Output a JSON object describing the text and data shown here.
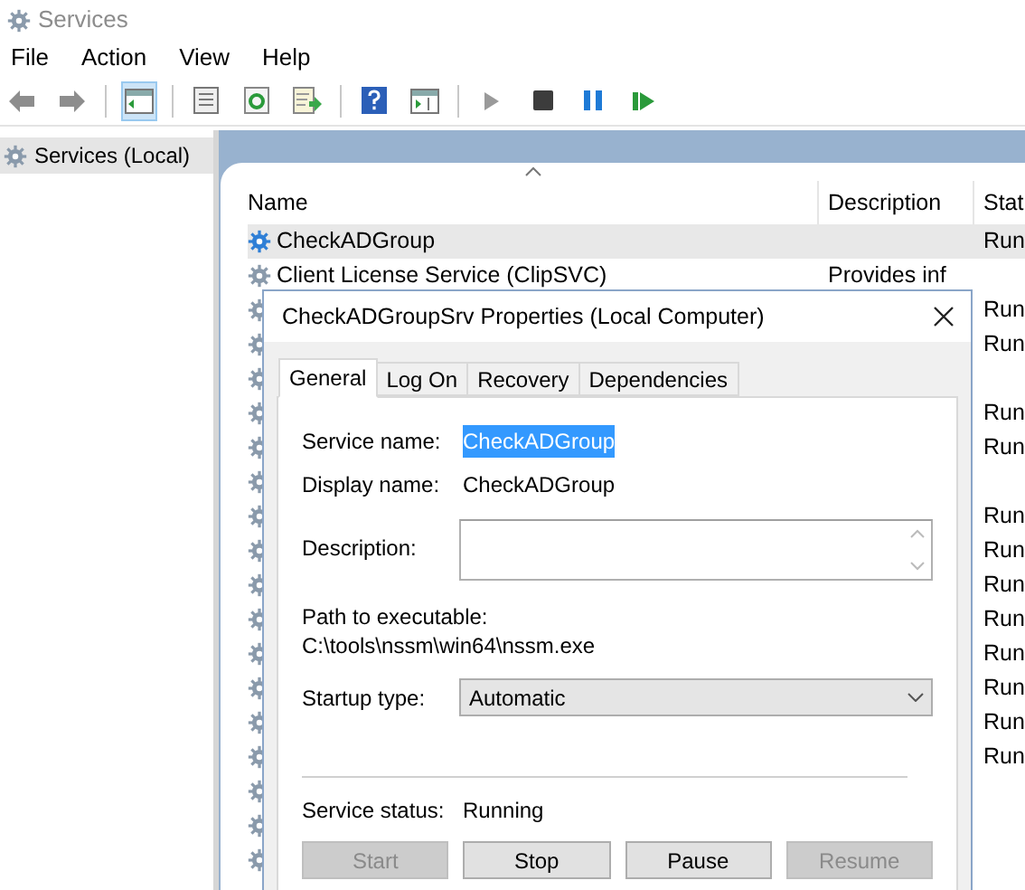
{
  "window": {
    "title": "Services"
  },
  "menu": [
    "File",
    "Action",
    "View",
    "Help"
  ],
  "toolbar": [
    {
      "items": [
        {
          "kind": "back",
          "selected": false
        },
        {
          "kind": "forward",
          "selected": false
        }
      ]
    },
    {
      "items": [
        {
          "kind": "tree",
          "selected": true
        }
      ]
    },
    {
      "items": [
        {
          "kind": "properties",
          "selected": false
        },
        {
          "kind": "refresh",
          "selected": false
        },
        {
          "kind": "export",
          "selected": false
        }
      ]
    },
    {
      "items": [
        {
          "kind": "help",
          "selected": false
        },
        {
          "kind": "console",
          "selected": false
        }
      ]
    },
    {
      "items": [
        {
          "kind": "start",
          "selected": false
        },
        {
          "kind": "stop",
          "selected": false
        },
        {
          "kind": "pause",
          "selected": false
        },
        {
          "kind": "resume",
          "selected": false
        }
      ]
    }
  ],
  "tree": [
    {
      "label": "Services (Local)",
      "selected": true
    }
  ],
  "list": {
    "columns": [
      "Name",
      "Description",
      "Stat"
    ],
    "rows": [
      {
        "name": "CheckADGroup",
        "description": "",
        "status": "Run",
        "selected": true
      },
      {
        "name": "Client License Service (ClipSVC)",
        "description": "Provides inf",
        "status": "",
        "selected": false
      },
      {
        "status": "Run",
        "selected": false
      },
      {
        "status": "Run",
        "selected": false
      },
      {
        "status": "",
        "selected": false
      },
      {
        "status": "Run",
        "selected": false
      },
      {
        "status": "Run",
        "selected": false
      },
      {
        "status": "",
        "selected": false
      },
      {
        "status": "Run",
        "selected": false
      },
      {
        "status": "Run",
        "selected": false
      },
      {
        "status": "Run",
        "selected": false
      },
      {
        "status": "Run",
        "selected": false
      },
      {
        "status": "Run",
        "selected": false
      },
      {
        "status": "Run",
        "selected": false
      },
      {
        "status": "Run",
        "selected": false
      },
      {
        "status": "Run",
        "selected": false
      },
      {
        "status": "",
        "selected": false
      },
      {
        "status": "",
        "selected": false
      },
      {
        "status": "",
        "selected": false
      }
    ]
  },
  "dialog": {
    "title": "CheckADGroupSrv Properties (Local Computer)",
    "tabs": [
      {
        "label": "General",
        "selected": true
      },
      {
        "label": "Log On",
        "selected": false
      },
      {
        "label": "Recovery",
        "selected": false
      },
      {
        "label": "Dependencies",
        "selected": false
      }
    ],
    "service_name": {
      "label": "Service name:",
      "value": "CheckADGroup",
      "selected": true
    },
    "display_name": {
      "label": "Display name:",
      "value": "CheckADGroup"
    },
    "description": {
      "label": "Description:"
    },
    "path": {
      "label": "Path to executable:",
      "value": "C:\\tools\\nssm\\win64\\nssm.exe"
    },
    "startup_type": {
      "label": "Startup type:",
      "value": "Automatic"
    },
    "service_status": {
      "label": "Service status:",
      "value": "Running"
    },
    "buttons": [
      {
        "label": "Start",
        "disabled": true
      },
      {
        "label": "Stop",
        "disabled": false
      },
      {
        "label": "Pause",
        "disabled": false
      },
      {
        "label": "Resume",
        "disabled": true
      }
    ]
  }
}
